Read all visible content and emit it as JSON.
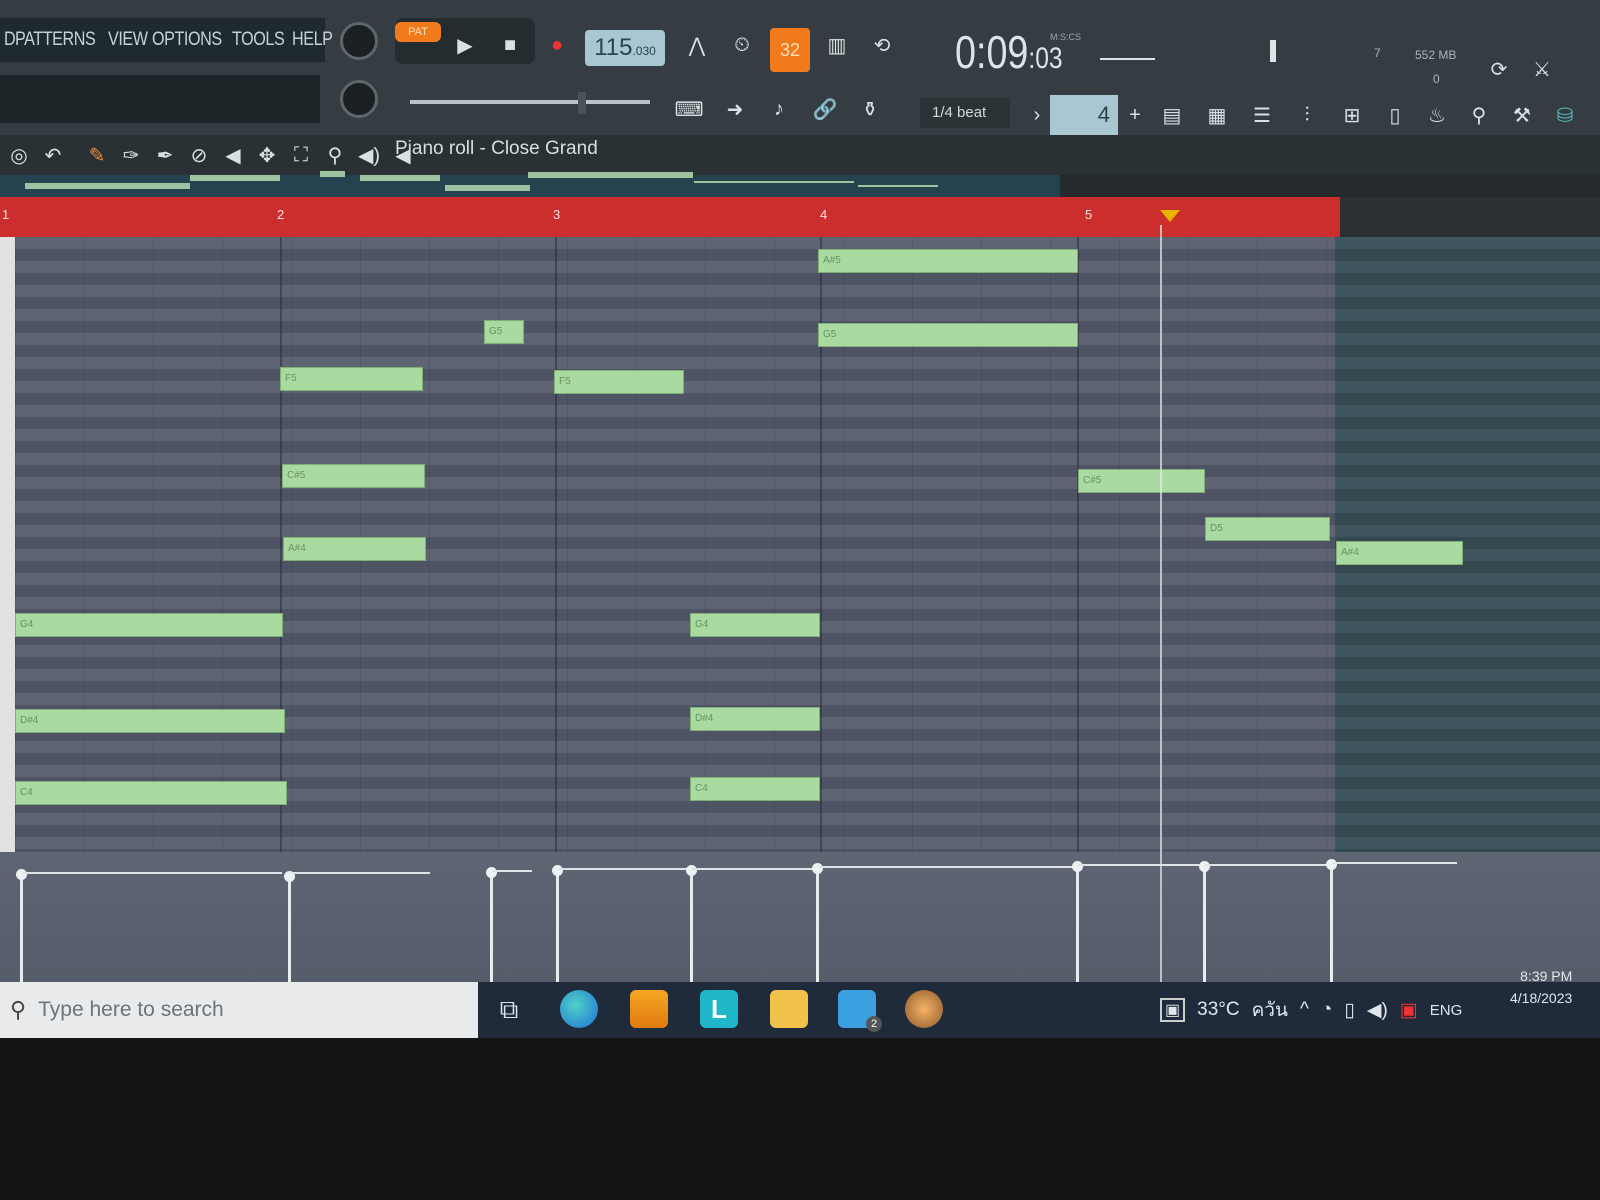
{
  "menu": [
    "D",
    "PATTERNS",
    "VIEW",
    "OPTIONS",
    "TOOLS",
    "HELP"
  ],
  "transport": {
    "mode": "PAT",
    "tempo": "115",
    "tempo_decimals": ".030",
    "counter": "32",
    "time": "0:09",
    "time_cs": ":03",
    "time_units": "M:S:CS"
  },
  "status": {
    "cpu": "7",
    "memory": "552 MB",
    "polyphony": "0"
  },
  "snap": {
    "label": "1/4 beat",
    "value": "4"
  },
  "piano_roll": {
    "title": "Piano roll - Close Grand",
    "bar_numbers": [
      "1",
      "2",
      "3",
      "4",
      "5"
    ],
    "notes": [
      {
        "label": "G4"
      },
      {
        "label": "D#4"
      },
      {
        "label": "C4"
      },
      {
        "label": "F5"
      },
      {
        "label": "C#5"
      },
      {
        "label": "A#4"
      },
      {
        "label": "G5"
      },
      {
        "label": "F5"
      },
      {
        "label": "G4"
      },
      {
        "label": "D#4"
      },
      {
        "label": "C4"
      },
      {
        "label": "A#5"
      },
      {
        "label": "G5"
      },
      {
        "label": "C#5"
      },
      {
        "label": "D5"
      },
      {
        "label": "A#4"
      }
    ]
  },
  "taskbar": {
    "search_placeholder": "Type here to search",
    "weather": "33°C",
    "weather_text": "ควัน",
    "lang": "ENG",
    "time": "8:39 PM",
    "date": "4/18/2023",
    "mail_badge": "2"
  },
  "icons": [
    "search-icon",
    "task-view-icon",
    "edge-icon",
    "store-icon",
    "l-app-icon",
    "file-explorer-icon",
    "mail-icon",
    "fl-studio-icon"
  ]
}
